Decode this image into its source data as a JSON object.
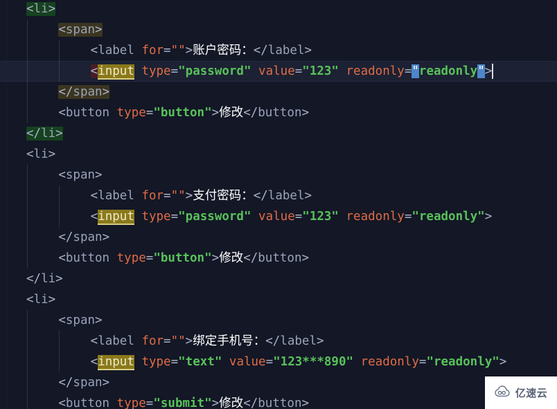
{
  "editor": {
    "language": "html",
    "theme_name": "dark",
    "colors": {
      "background": "#131726",
      "current_line": "#1c2133",
      "tag": "#9aa3b8",
      "punctuation": "#a9b1c6",
      "attribute": "#e06c45",
      "string": "#58c15a",
      "text": "#ffffff",
      "match_tag_highlight": "#16421f",
      "match_span_highlight": "#3b3520",
      "word_occurrence_highlight": "#8a7a1b",
      "selection": "#4d86c9",
      "caret": "#d9dee8"
    },
    "current_line_number": 4,
    "lines": [
      {
        "n": 1,
        "indent": 0,
        "current": false,
        "tokens": [
          {
            "t": "<",
            "c": "punc"
          },
          {
            "t": "li",
            "c": "tag"
          },
          {
            "t": ">",
            "c": "punc"
          }
        ],
        "highlight": "tagpair"
      },
      {
        "n": 2,
        "indent": 2,
        "current": false,
        "tokens": [
          {
            "t": "<",
            "c": "punc"
          },
          {
            "t": "span",
            "c": "tag"
          },
          {
            "t": ">",
            "c": "punc"
          }
        ],
        "highlight": "spanpair"
      },
      {
        "n": 3,
        "indent": 4,
        "current": false,
        "tokens": [
          {
            "t": "<",
            "c": "punc"
          },
          {
            "t": "label",
            "c": "tag"
          },
          {
            "t": " ",
            "c": "punc"
          },
          {
            "t": "for",
            "c": "attr"
          },
          {
            "t": "=",
            "c": "punc"
          },
          {
            "t": "\"\"",
            "c": "strq"
          },
          {
            "t": ">",
            "c": "punc"
          },
          {
            "t": "账户密码：",
            "c": "txt"
          },
          {
            "t": "</",
            "c": "punc"
          },
          {
            "t": "label",
            "c": "tag"
          },
          {
            "t": ">",
            "c": "punc"
          }
        ]
      },
      {
        "n": 4,
        "indent": 4,
        "current": true,
        "tokens": [
          {
            "t": "<",
            "c": "punc",
            "mark": "redmark"
          },
          {
            "t": "input",
            "c": "punc",
            "mark": "word"
          },
          {
            "t": " ",
            "c": "punc"
          },
          {
            "t": "type",
            "c": "attr"
          },
          {
            "t": "=",
            "c": "punc"
          },
          {
            "t": "\"password\"",
            "c": "str",
            "bold": true
          },
          {
            "t": " ",
            "c": "punc"
          },
          {
            "t": "value",
            "c": "attr"
          },
          {
            "t": "=",
            "c": "punc"
          },
          {
            "t": "\"123\"",
            "c": "str",
            "bold": true
          },
          {
            "t": " ",
            "c": "punc"
          },
          {
            "t": "readonly",
            "c": "attr"
          },
          {
            "t": "=",
            "c": "punc"
          },
          {
            "t": "\"",
            "c": "punc",
            "mark": "sel"
          },
          {
            "t": "readonly",
            "c": "str",
            "bold": true
          },
          {
            "t": "\"",
            "c": "punc",
            "mark": "sel"
          },
          {
            "t": ">",
            "c": "punc"
          }
        ],
        "caret_after": true
      },
      {
        "n": 5,
        "indent": 2,
        "current": false,
        "tokens": [
          {
            "t": "</",
            "c": "punc"
          },
          {
            "t": "span",
            "c": "tag"
          },
          {
            "t": ">",
            "c": "punc"
          }
        ],
        "highlight": "spanpair"
      },
      {
        "n": 6,
        "indent": 2,
        "current": false,
        "tokens": [
          {
            "t": "<",
            "c": "punc"
          },
          {
            "t": "button",
            "c": "tag"
          },
          {
            "t": " ",
            "c": "punc"
          },
          {
            "t": "type",
            "c": "attr"
          },
          {
            "t": "=",
            "c": "punc"
          },
          {
            "t": "\"button\"",
            "c": "str",
            "bold": true
          },
          {
            "t": ">",
            "c": "punc"
          },
          {
            "t": "修改",
            "c": "txt"
          },
          {
            "t": "</",
            "c": "punc"
          },
          {
            "t": "button",
            "c": "tag"
          },
          {
            "t": ">",
            "c": "punc"
          }
        ]
      },
      {
        "n": 7,
        "indent": 0,
        "current": false,
        "tokens": [
          {
            "t": "</",
            "c": "punc"
          },
          {
            "t": "li",
            "c": "tag"
          },
          {
            "t": ">",
            "c": "punc"
          }
        ],
        "highlight": "tagpair"
      },
      {
        "n": 8,
        "indent": 0,
        "current": false,
        "tokens": [
          {
            "t": "<",
            "c": "punc"
          },
          {
            "t": "li",
            "c": "tag"
          },
          {
            "t": ">",
            "c": "punc"
          }
        ]
      },
      {
        "n": 9,
        "indent": 2,
        "current": false,
        "tokens": [
          {
            "t": "<",
            "c": "punc"
          },
          {
            "t": "span",
            "c": "tag"
          },
          {
            "t": ">",
            "c": "punc"
          }
        ]
      },
      {
        "n": 10,
        "indent": 4,
        "current": false,
        "tokens": [
          {
            "t": "<",
            "c": "punc"
          },
          {
            "t": "label",
            "c": "tag"
          },
          {
            "t": " ",
            "c": "punc"
          },
          {
            "t": "for",
            "c": "attr"
          },
          {
            "t": "=",
            "c": "punc"
          },
          {
            "t": "\"\"",
            "c": "strq"
          },
          {
            "t": ">",
            "c": "punc"
          },
          {
            "t": "支付密码：",
            "c": "txt"
          },
          {
            "t": "</",
            "c": "punc"
          },
          {
            "t": "label",
            "c": "tag"
          },
          {
            "t": ">",
            "c": "punc"
          }
        ]
      },
      {
        "n": 11,
        "indent": 4,
        "current": false,
        "tokens": [
          {
            "t": "<",
            "c": "punc"
          },
          {
            "t": "input",
            "c": "punc",
            "mark": "word"
          },
          {
            "t": " ",
            "c": "punc"
          },
          {
            "t": "type",
            "c": "attr"
          },
          {
            "t": "=",
            "c": "punc"
          },
          {
            "t": "\"password\"",
            "c": "str",
            "bold": true
          },
          {
            "t": " ",
            "c": "punc"
          },
          {
            "t": "value",
            "c": "attr"
          },
          {
            "t": "=",
            "c": "punc"
          },
          {
            "t": "\"123\"",
            "c": "str",
            "bold": true
          },
          {
            "t": " ",
            "c": "punc"
          },
          {
            "t": "readonly",
            "c": "attr"
          },
          {
            "t": "=",
            "c": "punc"
          },
          {
            "t": "\"readonly\"",
            "c": "str",
            "bold": true
          },
          {
            "t": ">",
            "c": "punc"
          }
        ]
      },
      {
        "n": 12,
        "indent": 2,
        "current": false,
        "tokens": [
          {
            "t": "</",
            "c": "punc"
          },
          {
            "t": "span",
            "c": "tag"
          },
          {
            "t": ">",
            "c": "punc"
          }
        ]
      },
      {
        "n": 13,
        "indent": 2,
        "current": false,
        "tokens": [
          {
            "t": "<",
            "c": "punc"
          },
          {
            "t": "button",
            "c": "tag"
          },
          {
            "t": " ",
            "c": "punc"
          },
          {
            "t": "type",
            "c": "attr"
          },
          {
            "t": "=",
            "c": "punc"
          },
          {
            "t": "\"button\"",
            "c": "str",
            "bold": true
          },
          {
            "t": ">",
            "c": "punc"
          },
          {
            "t": "修改",
            "c": "txt"
          },
          {
            "t": "</",
            "c": "punc"
          },
          {
            "t": "button",
            "c": "tag"
          },
          {
            "t": ">",
            "c": "punc"
          }
        ]
      },
      {
        "n": 14,
        "indent": 0,
        "current": false,
        "tokens": [
          {
            "t": "</",
            "c": "punc"
          },
          {
            "t": "li",
            "c": "tag"
          },
          {
            "t": ">",
            "c": "punc"
          }
        ]
      },
      {
        "n": 15,
        "indent": 0,
        "current": false,
        "tokens": [
          {
            "t": "<",
            "c": "punc"
          },
          {
            "t": "li",
            "c": "tag"
          },
          {
            "t": ">",
            "c": "punc"
          }
        ]
      },
      {
        "n": 16,
        "indent": 2,
        "current": false,
        "tokens": [
          {
            "t": "<",
            "c": "punc"
          },
          {
            "t": "span",
            "c": "tag"
          },
          {
            "t": ">",
            "c": "punc"
          }
        ]
      },
      {
        "n": 17,
        "indent": 4,
        "current": false,
        "tokens": [
          {
            "t": "<",
            "c": "punc"
          },
          {
            "t": "label",
            "c": "tag"
          },
          {
            "t": " ",
            "c": "punc"
          },
          {
            "t": "for",
            "c": "attr"
          },
          {
            "t": "=",
            "c": "punc"
          },
          {
            "t": "\"\"",
            "c": "strq"
          },
          {
            "t": ">",
            "c": "punc"
          },
          {
            "t": "绑定手机号：",
            "c": "txt"
          },
          {
            "t": "</",
            "c": "punc"
          },
          {
            "t": "label",
            "c": "tag"
          },
          {
            "t": ">",
            "c": "punc"
          }
        ]
      },
      {
        "n": 18,
        "indent": 4,
        "current": false,
        "tokens": [
          {
            "t": "<",
            "c": "punc"
          },
          {
            "t": "input",
            "c": "punc",
            "mark": "word"
          },
          {
            "t": " ",
            "c": "punc"
          },
          {
            "t": "type",
            "c": "attr"
          },
          {
            "t": "=",
            "c": "punc"
          },
          {
            "t": "\"text\"",
            "c": "str",
            "bold": true
          },
          {
            "t": " ",
            "c": "punc"
          },
          {
            "t": "value",
            "c": "attr"
          },
          {
            "t": "=",
            "c": "punc"
          },
          {
            "t": "\"123***890\"",
            "c": "str",
            "bold": true
          },
          {
            "t": " ",
            "c": "punc"
          },
          {
            "t": "readonly",
            "c": "attr"
          },
          {
            "t": "=",
            "c": "punc"
          },
          {
            "t": "\"readonly\"",
            "c": "str",
            "bold": true
          },
          {
            "t": ">",
            "c": "punc"
          }
        ]
      },
      {
        "n": 19,
        "indent": 2,
        "current": false,
        "tokens": [
          {
            "t": "</",
            "c": "punc"
          },
          {
            "t": "span",
            "c": "tag"
          },
          {
            "t": ">",
            "c": "punc"
          }
        ]
      },
      {
        "n": 20,
        "indent": 2,
        "current": false,
        "tokens": [
          {
            "t": "<",
            "c": "punc"
          },
          {
            "t": "button",
            "c": "tag"
          },
          {
            "t": " ",
            "c": "punc"
          },
          {
            "t": "type",
            "c": "attr"
          },
          {
            "t": "=",
            "c": "punc"
          },
          {
            "t": "\"submit\"",
            "c": "str",
            "bold": true
          },
          {
            "t": ">",
            "c": "punc"
          },
          {
            "t": "修改",
            "c": "txt"
          },
          {
            "t": "</",
            "c": "punc"
          },
          {
            "t": "button",
            "c": "tag"
          },
          {
            "t": ">",
            "c": "punc"
          }
        ]
      }
    ]
  },
  "watermark": {
    "text": "亿速云",
    "icon": "cloud-icon"
  }
}
